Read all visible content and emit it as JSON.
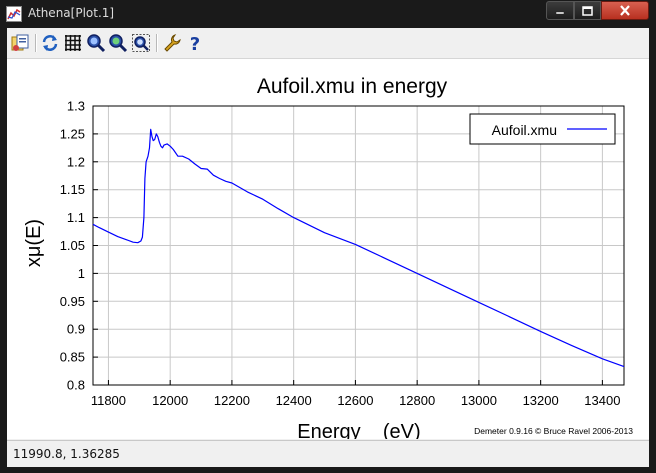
{
  "window": {
    "title": "Athena[Plot.1]"
  },
  "toolbar": {
    "items": [
      {
        "icon": "save-icon"
      },
      {
        "icon": "refresh-icon"
      },
      {
        "icon": "grid-icon"
      },
      {
        "icon": "zoom-in-icon"
      },
      {
        "icon": "zoom-out-icon"
      },
      {
        "icon": "zoom-fit-icon"
      },
      {
        "icon": "wrench-icon"
      },
      {
        "icon": "help-icon"
      }
    ]
  },
  "status": {
    "text": "11990.8,  1.36285"
  },
  "chart_data": {
    "type": "line",
    "title": "Aufoil.xmu in energy",
    "xlabel": "Energy    (eV)",
    "ylabel": "xμ(E)",
    "credit": "Demeter 0.9.16 © Bruce Ravel 2006-2013",
    "xlim": [
      11750,
      13470
    ],
    "ylim": [
      0.8,
      1.3
    ],
    "xticks": [
      11800,
      12000,
      12200,
      12400,
      12600,
      12800,
      13000,
      13200,
      13400
    ],
    "yticks": [
      0.8,
      0.85,
      0.9,
      0.95,
      1,
      1.05,
      1.1,
      1.15,
      1.2,
      1.25,
      1.3
    ],
    "grid": true,
    "legend_position": "top-right",
    "series": [
      {
        "name": "Aufoil.xmu",
        "color": "#0000ff",
        "x": [
          11750,
          11770,
          11800,
          11830,
          11860,
          11880,
          11895,
          11905,
          11910,
          11915,
          11918,
          11922,
          11928,
          11933,
          11937,
          11941,
          11945,
          11950,
          11955,
          11960,
          11965,
          11970,
          11975,
          11980,
          11990,
          12000,
          12010,
          12025,
          12040,
          12060,
          12080,
          12100,
          12120,
          12140,
          12160,
          12180,
          12200,
          12250,
          12300,
          12350,
          12400,
          12500,
          12600,
          12700,
          12800,
          12900,
          13000,
          13100,
          13200,
          13300,
          13400,
          13470
        ],
        "y": [
          1.088,
          1.082,
          1.074,
          1.066,
          1.06,
          1.056,
          1.055,
          1.058,
          1.065,
          1.1,
          1.17,
          1.2,
          1.21,
          1.225,
          1.258,
          1.245,
          1.238,
          1.24,
          1.25,
          1.245,
          1.235,
          1.228,
          1.225,
          1.23,
          1.232,
          1.228,
          1.222,
          1.21,
          1.21,
          1.205,
          1.196,
          1.188,
          1.187,
          1.176,
          1.17,
          1.165,
          1.162,
          1.146,
          1.133,
          1.116,
          1.1,
          1.073,
          1.052,
          1.026,
          1.0,
          0.974,
          0.948,
          0.922,
          0.896,
          0.871,
          0.847,
          0.833
        ]
      }
    ]
  }
}
